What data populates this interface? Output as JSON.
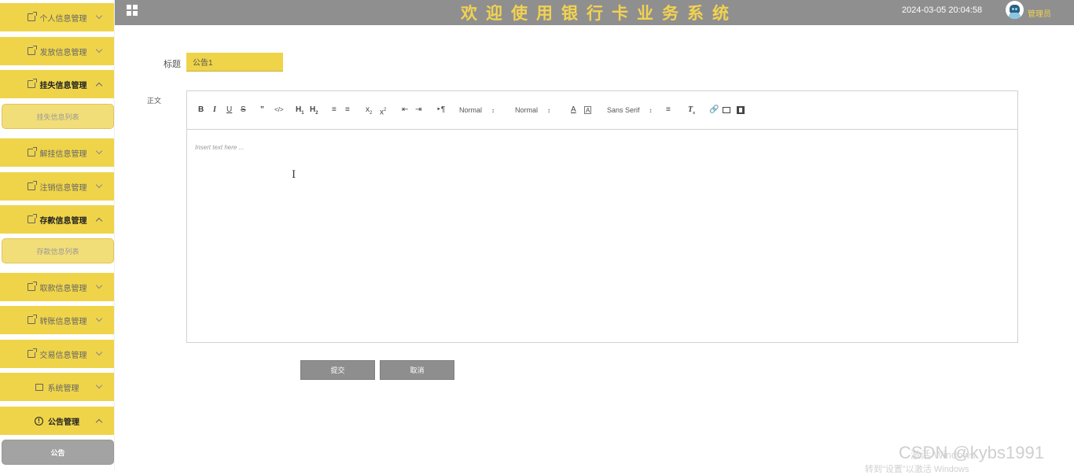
{
  "header": {
    "title": "欢迎使用银行卡业务系统",
    "datetime": "2024-03-05 20:04:58",
    "role": "管理员",
    "colors": {
      "bar": "#8f8f8f",
      "accent": "#f2d24f"
    }
  },
  "sidebar": {
    "items": [
      {
        "label": "个人信息管理",
        "icon": "doc-icon",
        "open": false
      },
      {
        "label": "发放信息管理",
        "icon": "doc-icon",
        "open": false
      },
      {
        "label": "挂失信息管理",
        "icon": "doc-icon",
        "open": true,
        "sub": "挂失信息列表"
      },
      {
        "label": "解挂信息管理",
        "icon": "doc-icon",
        "open": false
      },
      {
        "label": "注销信息管理",
        "icon": "doc-icon",
        "open": false
      },
      {
        "label": "存款信息管理",
        "icon": "doc-icon",
        "open": true,
        "sub": "存款信息列表"
      },
      {
        "label": "取款信息管理",
        "icon": "doc-icon",
        "open": false
      },
      {
        "label": "转账信息管理",
        "icon": "doc-icon",
        "open": false
      },
      {
        "label": "交易信息管理",
        "icon": "doc-icon",
        "open": false
      },
      {
        "label": "系统管理",
        "icon": "image-icon",
        "open": false
      },
      {
        "label": "公告管理",
        "icon": "alert-icon",
        "open": true,
        "sub": "公告"
      }
    ]
  },
  "form": {
    "title_label": "标题",
    "title_value": "公告1",
    "content_label": "正文",
    "editor_placeholder": "Insert text here ...",
    "toolbar": {
      "header_select": "Normal",
      "size_select": "Normal",
      "font_select": "Sans Serif"
    },
    "submit_label": "提交",
    "cancel_label": "取消"
  },
  "watermark": {
    "csdn": "CSDN @kybs1991",
    "activate": "激活 Windows",
    "activate_sub": "转到\"设置\"以激活 Windows"
  }
}
